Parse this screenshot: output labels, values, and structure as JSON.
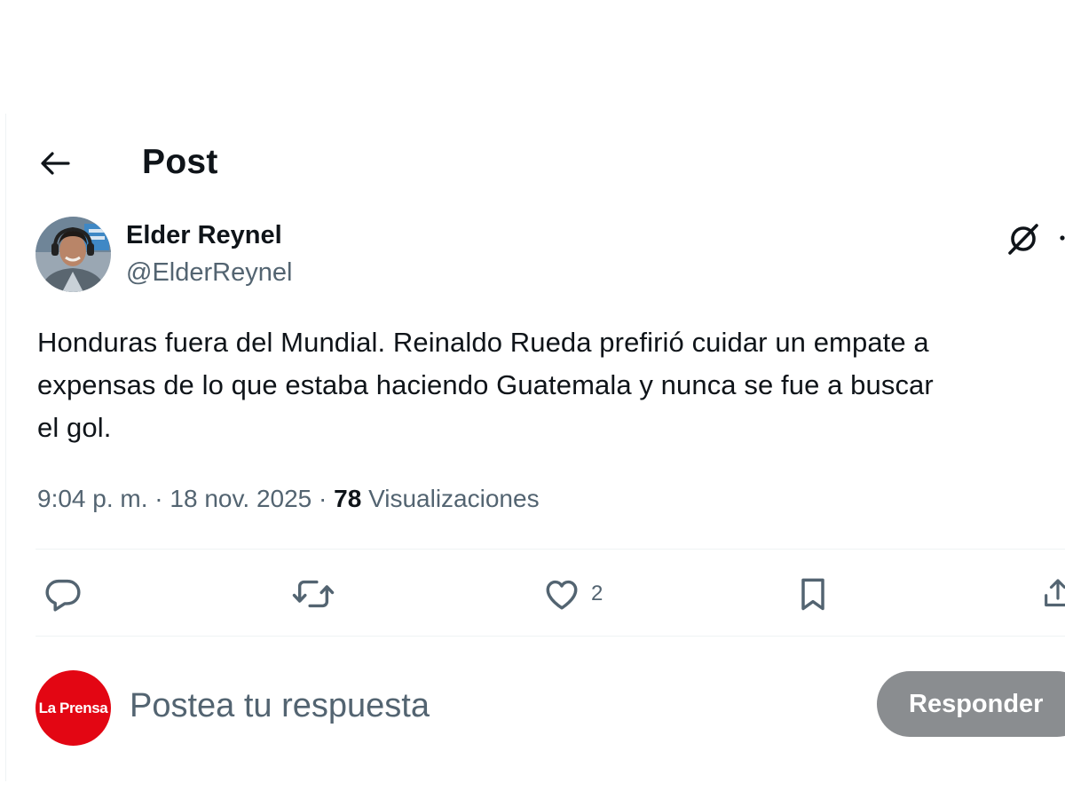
{
  "header": {
    "back_icon": "arrow-left-icon",
    "title": "Post"
  },
  "author": {
    "name": "Elder Reynel",
    "handle": "@ElderReynel"
  },
  "post": {
    "text": "Honduras fuera del Mundial. Reinaldo Rueda prefirió cuidar un empate a\nexpensas de lo que estaba haciendo Guatemala y nunca se fue a buscar\nel gol.",
    "time": "9:04 p. m.",
    "separator": "·",
    "date": "18 nov. 2025",
    "views_count": "78",
    "views_label": "Visualizaciones"
  },
  "actions": {
    "reply_icon": "reply-icon",
    "repost_icon": "repost-icon",
    "like_icon": "heart-icon",
    "like_count": "2",
    "bookmark_icon": "bookmark-icon",
    "share_icon": "share-icon"
  },
  "composer": {
    "avatar_text": "La Prensa",
    "placeholder": "Postea tu respuesta",
    "reply_button": "Responder"
  },
  "colors": {
    "text": "#0f1419",
    "secondary": "#536471",
    "divider": "#eff3f4",
    "brand_red": "#e30613",
    "button_disabled": "#8a8d90"
  }
}
